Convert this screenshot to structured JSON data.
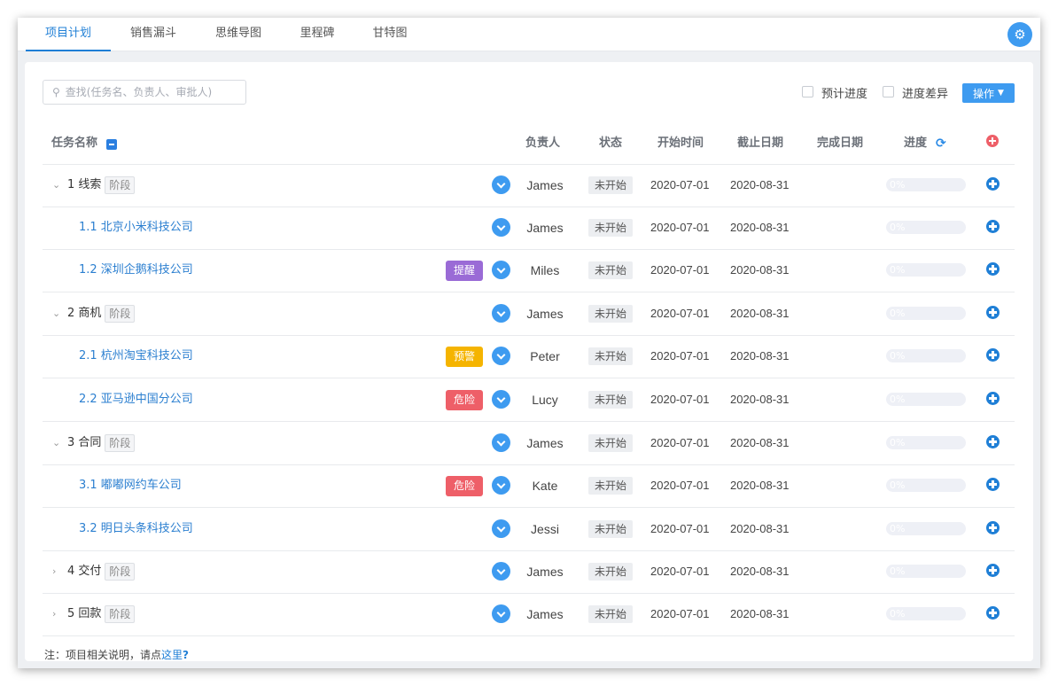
{
  "tabs": [
    {
      "label": "项目计划",
      "active": true
    },
    {
      "label": "销售漏斗",
      "active": false
    },
    {
      "label": "思维导图",
      "active": false
    },
    {
      "label": "里程碑",
      "active": false
    },
    {
      "label": "甘特图",
      "active": false
    }
  ],
  "toolbar": {
    "search_placeholder": "查找(任务名、负责人、审批人)",
    "planned_progress_label": "预计进度",
    "progress_diff_label": "进度差异",
    "ops_label": "操作"
  },
  "columns": {
    "task_name": "任务名称",
    "owner": "负责人",
    "status": "状态",
    "start": "开始时间",
    "deadline": "截止日期",
    "done": "完成日期",
    "progress": "进度"
  },
  "stage_tag": "阶段",
  "rows": [
    {
      "label": "1 线索",
      "level": 0,
      "expanded": true,
      "alert": "",
      "alert_color": "",
      "owner": "James",
      "status": "未开始",
      "start": "2020-07-01",
      "deadline": "2020-08-31",
      "done": "",
      "progress_text": "0%",
      "progress": 0
    },
    {
      "label": "1.1 北京小米科技公司",
      "level": 1,
      "alert": "",
      "alert_color": "",
      "owner": "James",
      "status": "未开始",
      "start": "2020-07-01",
      "deadline": "2020-08-31",
      "done": "",
      "progress_text": "0%",
      "progress": 0
    },
    {
      "label": "1.2 深圳企鹅科技公司",
      "level": 1,
      "alert": "提醒",
      "alert_color": "#9a6bd6",
      "owner": "Miles",
      "status": "未开始",
      "start": "2020-07-01",
      "deadline": "2020-08-31",
      "done": "",
      "progress_text": "0%",
      "progress": 0
    },
    {
      "label": "2 商机",
      "level": 0,
      "expanded": true,
      "alert": "",
      "alert_color": "",
      "owner": "James",
      "status": "未开始",
      "start": "2020-07-01",
      "deadline": "2020-08-31",
      "done": "",
      "progress_text": "0%",
      "progress": 0
    },
    {
      "label": "2.1 杭州淘宝科技公司",
      "level": 1,
      "alert": "预警",
      "alert_color": "#f5b400",
      "owner": "Peter",
      "status": "未开始",
      "start": "2020-07-01",
      "deadline": "2020-08-31",
      "done": "",
      "progress_text": "0%",
      "progress": 0
    },
    {
      "label": "2.2 亚马逊中国分公司",
      "level": 1,
      "alert": "危险",
      "alert_color": "#ee5f68",
      "owner": "Lucy",
      "status": "未开始",
      "start": "2020-07-01",
      "deadline": "2020-08-31",
      "done": "",
      "progress_text": "0%",
      "progress": 0
    },
    {
      "label": "3 合同",
      "level": 0,
      "expanded": true,
      "alert": "",
      "alert_color": "",
      "owner": "James",
      "status": "未开始",
      "start": "2020-07-01",
      "deadline": "2020-08-31",
      "done": "",
      "progress_text": "0%",
      "progress": 0
    },
    {
      "label": "3.1 嘟嘟网约车公司",
      "level": 1,
      "alert": "危险",
      "alert_color": "#ee5f68",
      "owner": "Kate",
      "status": "未开始",
      "start": "2020-07-01",
      "deadline": "2020-08-31",
      "done": "",
      "progress_text": "0%",
      "progress": 0
    },
    {
      "label": "3.2 明日头条科技公司",
      "level": 1,
      "alert": "",
      "alert_color": "",
      "owner": "Jessi",
      "status": "未开始",
      "start": "2020-07-01",
      "deadline": "2020-08-31",
      "done": "",
      "progress_text": "0%",
      "progress": 0
    },
    {
      "label": "4 交付",
      "level": 0,
      "expanded": false,
      "alert": "",
      "alert_color": "",
      "owner": "James",
      "status": "未开始",
      "start": "2020-07-01",
      "deadline": "2020-08-31",
      "done": "",
      "progress_text": "0%",
      "progress": 0
    },
    {
      "label": "5 回款",
      "level": 0,
      "expanded": false,
      "alert": "",
      "alert_color": "",
      "owner": "James",
      "status": "未开始",
      "start": "2020-07-01",
      "deadline": "2020-08-31",
      "done": "",
      "progress_text": "0%",
      "progress": 0
    }
  ],
  "footer": {
    "note_prefix": "注：项目相关说明，请点",
    "note_link": "这里",
    "note_q": "?"
  },
  "colors": {
    "accent": "#3e9bf0",
    "link": "#1f7fd6",
    "danger": "#ee5f68"
  }
}
